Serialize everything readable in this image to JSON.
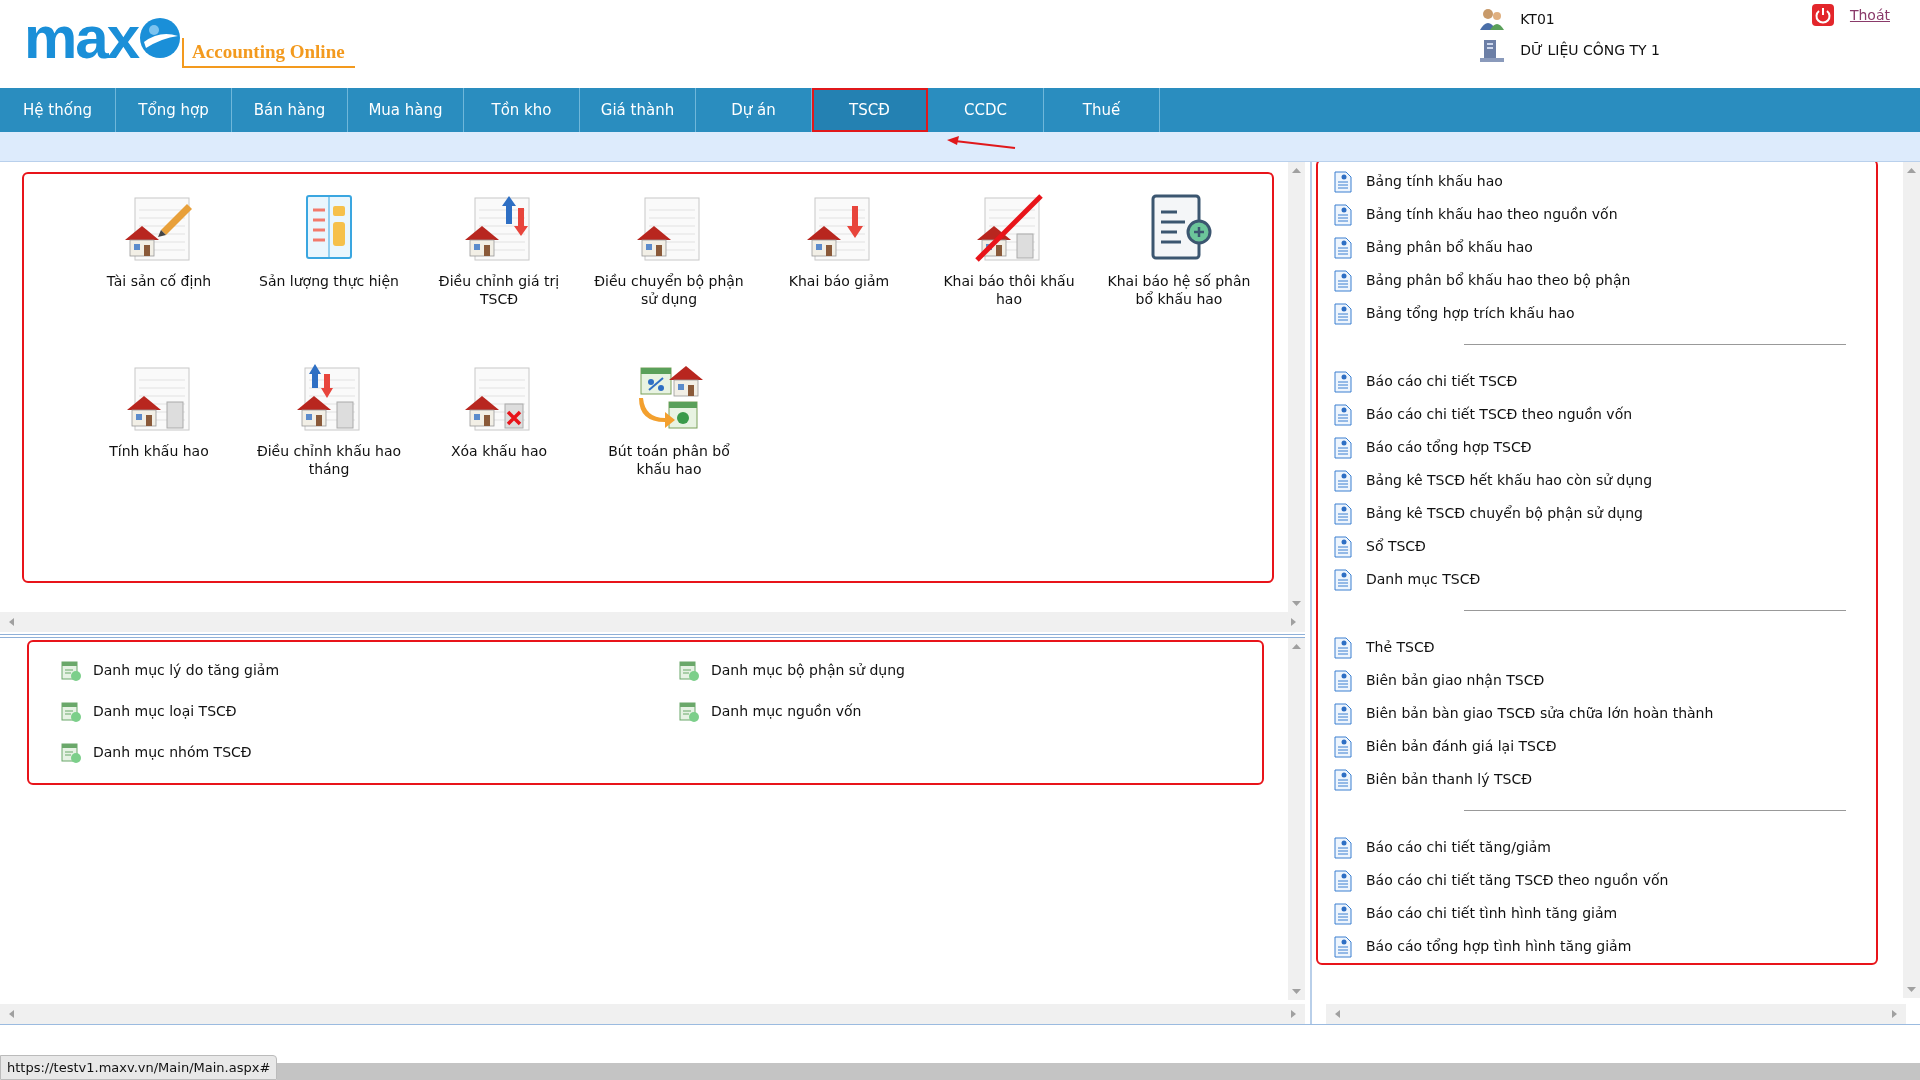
{
  "header": {
    "logo": {
      "mark": "max",
      "tagline": "Accounting Online"
    },
    "user": "KT01",
    "company": "DỮ LIỆU CÔNG TY 1",
    "logout": "Thoát"
  },
  "tabs": [
    {
      "label": "Hệ thống",
      "selected": false,
      "highlighted": false
    },
    {
      "label": "Tổng hợp",
      "selected": false,
      "highlighted": false
    },
    {
      "label": "Bán hàng",
      "selected": false,
      "highlighted": false
    },
    {
      "label": "Mua hàng",
      "selected": false,
      "highlighted": false
    },
    {
      "label": "Tồn kho",
      "selected": false,
      "highlighted": false
    },
    {
      "label": "Giá thành",
      "selected": false,
      "highlighted": false
    },
    {
      "label": "Dự án",
      "selected": false,
      "highlighted": false
    },
    {
      "label": "TSCĐ",
      "selected": true,
      "highlighted": true
    },
    {
      "label": "CCDC",
      "selected": false,
      "highlighted": false
    },
    {
      "label": "Thuế",
      "selected": false,
      "highlighted": false
    }
  ],
  "functions": [
    {
      "label": "Tài sản cố định",
      "kind": "asset"
    },
    {
      "label": "Sản lượng thực hiện",
      "kind": "output"
    },
    {
      "label": "Điều chỉnh giá trị TSCĐ",
      "kind": "adjust"
    },
    {
      "label": "Điều chuyển bộ phận sử dụng",
      "kind": "transfer"
    },
    {
      "label": "Khai báo giảm",
      "kind": "decrease"
    },
    {
      "label": "Khai báo thôi khấu hao",
      "kind": "stop"
    },
    {
      "label": "Khai báo hệ số phân bổ khấu hao",
      "kind": "coefficient"
    },
    {
      "label": "Tính khấu hao",
      "kind": "depreciate"
    },
    {
      "label": "Điều chỉnh khấu hao tháng",
      "kind": "adjust-month"
    },
    {
      "label": "Xóa khấu hao",
      "kind": "delete"
    },
    {
      "label": "Bút toán phân bổ khấu hao",
      "kind": "entry"
    }
  ],
  "catalogs": [
    {
      "label": "Danh mục lý do tăng giảm"
    },
    {
      "label": "Danh mục bộ phận sử dụng"
    },
    {
      "label": "Danh mục loại TSCĐ"
    },
    {
      "label": "Danh mục nguồn vốn"
    },
    {
      "label": "Danh mục nhóm TSCĐ"
    }
  ],
  "report_groups": [
    {
      "items": [
        "Bảng tính khấu hao",
        "Bảng tính khấu hao theo nguồn vốn",
        "Bảng phân bổ khấu hao",
        "Bảng phân bổ khấu hao theo bộ phận",
        "Bảng tổng hợp trích khấu hao"
      ]
    },
    {
      "items": [
        "Báo cáo chi tiết TSCĐ",
        "Báo cáo chi tiết TSCĐ theo nguồn vốn",
        "Báo cáo tổng hợp TSCĐ",
        "Bảng kê TSCĐ hết khấu hao còn sử dụng",
        "Bảng kê TSCĐ chuyển bộ phận sử dụng",
        "Sổ TSCĐ",
        "Danh mục TSCĐ"
      ]
    },
    {
      "items": [
        "Thẻ TSCĐ",
        "Biên bản giao nhận TSCĐ",
        "Biên bản bàn giao TSCĐ sửa chữa lớn hoàn thành",
        "Biên bản đánh giá lại TSCĐ",
        "Biên bản thanh lý TSCĐ"
      ]
    },
    {
      "items": [
        "Báo cáo chi tiết tăng/giảm",
        "Báo cáo chi tiết tăng TSCĐ theo nguồn vốn",
        "Báo cáo chi tiết tình hình tăng giảm",
        "Báo cáo tổng hợp tình hình tăng giảm"
      ]
    }
  ],
  "status_url": "https://testv1.maxv.vn/Main/Main.aspx#"
}
